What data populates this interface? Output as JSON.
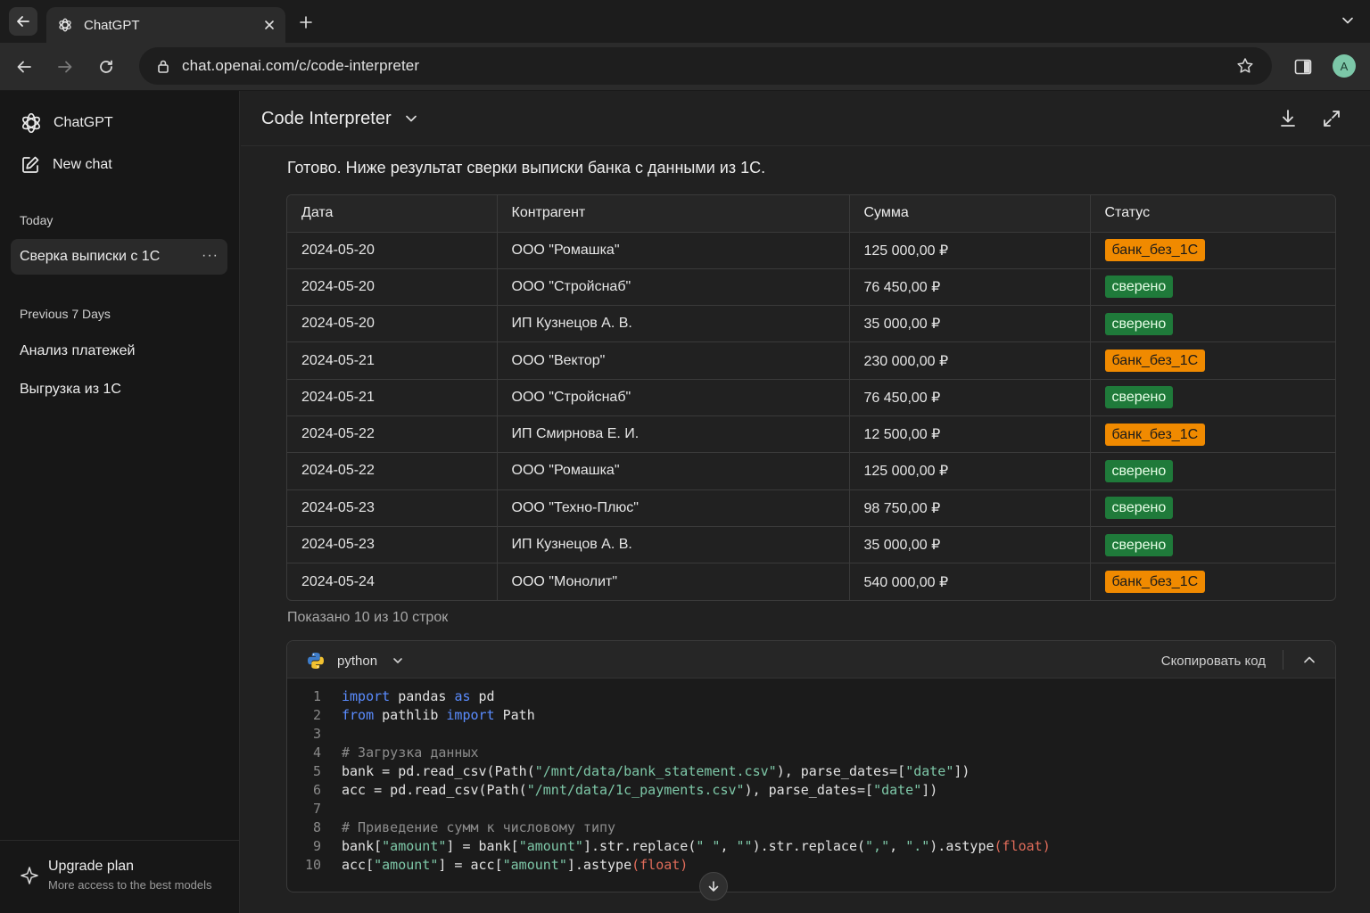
{
  "browser": {
    "tab_title": "ChatGPT",
    "url": "chat.openai.com/c/code-interpreter",
    "profile_initial": "A"
  },
  "sidebar": {
    "brand": "ChatGPT",
    "new_chat": "New chat",
    "sections": [
      {
        "heading": "Today",
        "items": [
          {
            "label": "Сверка выписки с 1С",
            "active": true
          }
        ]
      },
      {
        "heading": "Previous 7 Days",
        "items": [
          {
            "label": "Анализ платежей"
          },
          {
            "label": "Выгрузка из 1С"
          }
        ]
      }
    ],
    "more_label": "···",
    "upgrade_title": "Upgrade plan",
    "upgrade_subtitle": "More access to the best models"
  },
  "header": {
    "model": "Code Interpreter"
  },
  "message": {
    "intro": "Готово. Ниже результат сверки выписки банка с данными из 1С.",
    "table": {
      "columns": [
        "Дата",
        "Контрагент",
        "Сумма",
        "Статус"
      ],
      "rows": [
        [
          "2024-05-20",
          "ООО \"Ромашка\"",
          "125 000,00 ₽",
          "банк_без_1С"
        ],
        [
          "2024-05-20",
          "ООО \"Стройснаб\"",
          "76 450,00 ₽",
          "сверено"
        ],
        [
          "2024-05-20",
          "ИП Кузнецов А. В.",
          "35 000,00 ₽",
          "сверено"
        ],
        [
          "2024-05-21",
          "ООО \"Вектор\"",
          "230 000,00 ₽",
          "банк_без_1С"
        ],
        [
          "2024-05-21",
          "ООО \"Стройснаб\"",
          "76 450,00 ₽",
          "сверено"
        ],
        [
          "2024-05-22",
          "ИП Смирнова Е. И.",
          "12 500,00 ₽",
          "банк_без_1С"
        ],
        [
          "2024-05-22",
          "ООО \"Ромашка\"",
          "125 000,00 ₽",
          "сверено"
        ],
        [
          "2024-05-23",
          "ООО \"Техно-Плюс\"",
          "98 750,00 ₽",
          "сверено"
        ],
        [
          "2024-05-23",
          "ИП Кузнецов А. В.",
          "35 000,00 ₽",
          "сверено"
        ],
        [
          "2024-05-24",
          "ООО \"Монолит\"",
          "540 000,00 ₽",
          "банк_без_1С"
        ]
      ]
    },
    "rows_info": "Показано 10 из 10 строк"
  },
  "code": {
    "language": "python",
    "copy_label": "Скопировать код",
    "lines": [
      [
        [
          "kw",
          "import"
        ],
        [
          "t",
          " pandas "
        ],
        [
          "kw",
          "as"
        ],
        [
          "t",
          " pd"
        ]
      ],
      [
        [
          "kw",
          "from"
        ],
        [
          "t",
          " pathlib "
        ],
        [
          "kw",
          "import"
        ],
        [
          "t",
          " Path"
        ]
      ],
      [],
      [
        [
          "cm",
          "# Загрузка данных"
        ]
      ],
      [
        [
          "t",
          "bank = pd.read_csv(Path("
        ],
        [
          "str",
          "\"/mnt/data/bank_statement.csv\""
        ],
        [
          "t",
          "), parse_dates=["
        ],
        [
          "str",
          "\"date\""
        ],
        [
          "t",
          "])"
        ]
      ],
      [
        [
          "t",
          "acc = pd.read_csv(Path("
        ],
        [
          "str",
          "\"/mnt/data/1c_payments.csv\""
        ],
        [
          "t",
          "), parse_dates=["
        ],
        [
          "str",
          "\"date\""
        ],
        [
          "t",
          "])"
        ]
      ],
      [],
      [
        [
          "cm",
          "# Приведение сумм к числовому типу"
        ]
      ],
      [
        [
          "t",
          "bank["
        ],
        [
          "str",
          "\"amount\""
        ],
        [
          "t",
          "] = bank["
        ],
        [
          "str",
          "\"amount\""
        ],
        [
          "t",
          "].str.replace("
        ],
        [
          "str",
          "\" \""
        ],
        [
          "t",
          ", "
        ],
        [
          "str",
          "\"\""
        ],
        [
          "t",
          ").str.replace("
        ],
        [
          "str",
          "\",\""
        ],
        [
          "t",
          ", "
        ],
        [
          "str",
          "\".\""
        ],
        [
          "t",
          ").astype"
        ],
        [
          "fn",
          "(float)"
        ]
      ],
      [
        [
          "t",
          "acc["
        ],
        [
          "str",
          "\"amount\""
        ],
        [
          "t",
          "] = acc["
        ],
        [
          "str",
          "\"amount\""
        ],
        [
          "t",
          "].astype"
        ],
        [
          "fn",
          "(float)"
        ]
      ]
    ]
  },
  "colors": {
    "status_warn": "#f08a00",
    "status_ok": "#1f7a3a",
    "keyword": "#5a8cff",
    "string": "#7ec8a8"
  },
  "icons": [
    "back-arrow-icon",
    "chatgpt-logo-icon",
    "close-icon",
    "plus-icon",
    "chevron-down-icon",
    "forward-arrow-icon",
    "reload-icon",
    "lock-icon",
    "star-icon",
    "side-panel-icon",
    "edit-icon",
    "sparkle-icon",
    "download-icon",
    "expand-icon",
    "python-logo-icon",
    "chevron-up-icon",
    "arrow-down-icon"
  ]
}
